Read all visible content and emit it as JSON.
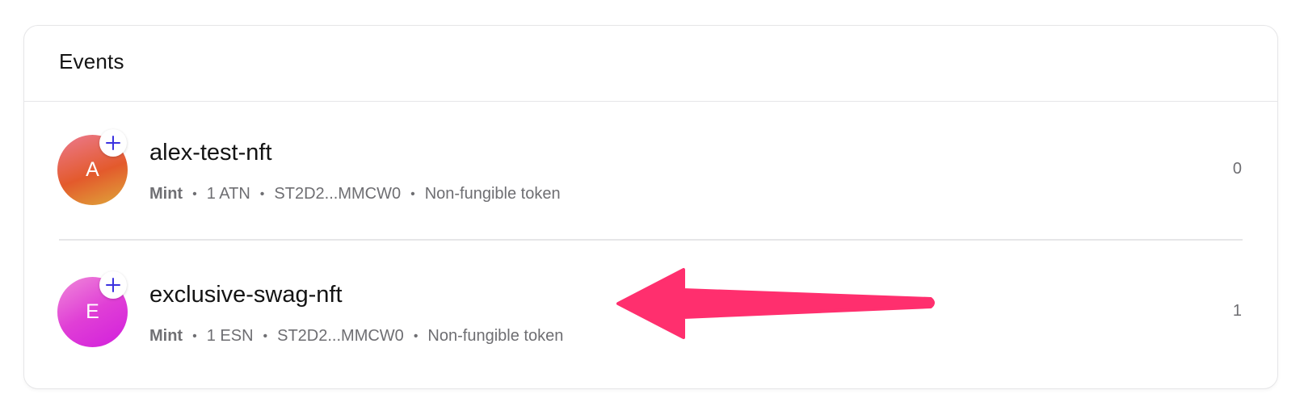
{
  "panel": {
    "title": "Events"
  },
  "events": [
    {
      "avatar_letter": "A",
      "name": "alex-test-nft",
      "type": "Mint",
      "amount": "1 ATN",
      "address": "ST2D2...MMCW0",
      "token_kind": "Non-fungible token",
      "count": "0"
    },
    {
      "avatar_letter": "E",
      "name": "exclusive-swag-nft",
      "type": "Mint",
      "amount": "1 ESN",
      "address": "ST2D2...MMCW0",
      "token_kind": "Non-fungible token",
      "count": "1"
    }
  ],
  "colors": {
    "annotation_arrow": "#ff2f6e",
    "plus_icon": "#3b32e0"
  },
  "icons": {
    "badge": "plus-icon",
    "annotation": "arrow-annotation"
  }
}
